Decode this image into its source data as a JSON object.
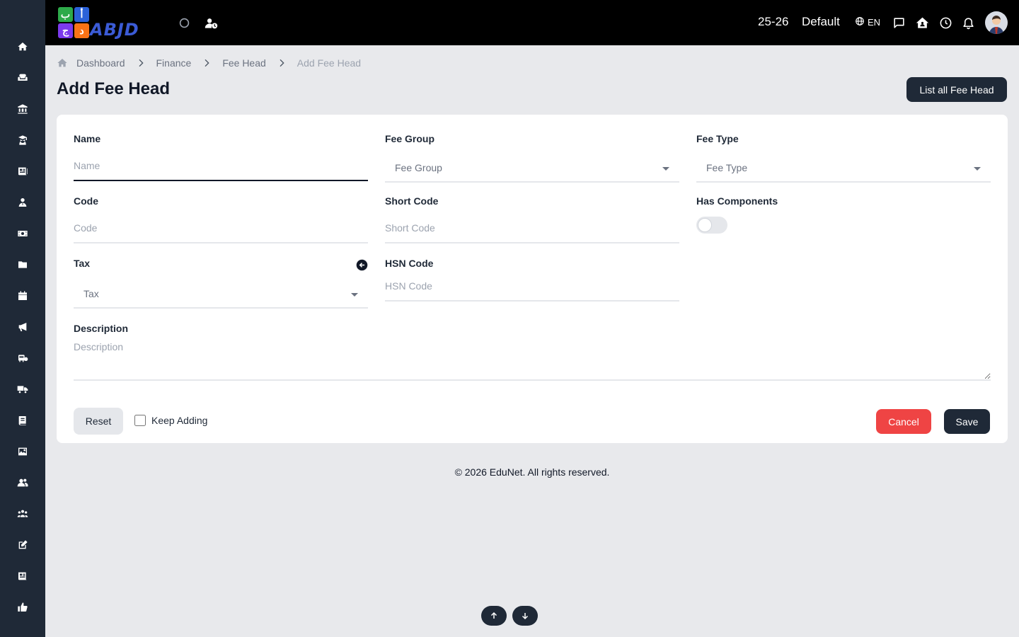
{
  "sidebar": {
    "items": [
      {
        "name": "home-icon"
      },
      {
        "name": "sofa-icon"
      },
      {
        "name": "bank-icon"
      },
      {
        "name": "graduate-icon"
      },
      {
        "name": "news-icon"
      },
      {
        "name": "user-tie-icon"
      },
      {
        "name": "money-icon"
      },
      {
        "name": "folder-icon"
      },
      {
        "name": "calendar-icon"
      },
      {
        "name": "megaphone-icon"
      },
      {
        "name": "bus-icon"
      },
      {
        "name": "truck-icon"
      },
      {
        "name": "book-icon"
      },
      {
        "name": "image-icon"
      },
      {
        "name": "users-icon"
      },
      {
        "name": "people-group-icon"
      },
      {
        "name": "edit-icon"
      },
      {
        "name": "newspaper-icon"
      },
      {
        "name": "thumbs-up-icon"
      }
    ]
  },
  "topbar": {
    "logo_text": "ABJD",
    "logo_tiles": [
      "ب",
      "أ",
      "ج",
      "د"
    ],
    "session": "25-26",
    "branch": "Default",
    "language": "EN"
  },
  "breadcrumb": {
    "items": [
      "Dashboard",
      "Finance",
      "Fee Head"
    ],
    "current": "Add Fee Head"
  },
  "page": {
    "title": "Add Fee Head",
    "list_button": "List all Fee Head"
  },
  "form": {
    "name": {
      "label": "Name",
      "placeholder": "Name",
      "value": ""
    },
    "fee_group": {
      "label": "Fee Group",
      "selected": "Fee Group"
    },
    "fee_type": {
      "label": "Fee Type",
      "selected": "Fee Type"
    },
    "code": {
      "label": "Code",
      "placeholder": "Code",
      "value": ""
    },
    "short_code": {
      "label": "Short Code",
      "placeholder": "Short Code",
      "value": ""
    },
    "has_components": {
      "label": "Has Components",
      "checked": false
    },
    "tax": {
      "label": "Tax",
      "selected": "Tax"
    },
    "hsn_code": {
      "label": "HSN Code",
      "placeholder": "HSN Code",
      "value": ""
    },
    "description": {
      "label": "Description",
      "placeholder": "Description",
      "value": ""
    },
    "reset_label": "Reset",
    "keep_adding_label": "Keep Adding",
    "cancel_label": "Cancel",
    "save_label": "Save"
  },
  "footer": {
    "text": "© 2026 EduNet. All rights reserved."
  },
  "colors": {
    "sidebar": "#1f2937",
    "topbar": "#000000",
    "background": "#e8e9ec",
    "primary_button": "#1f2937",
    "cancel_button": "#ef4444"
  }
}
